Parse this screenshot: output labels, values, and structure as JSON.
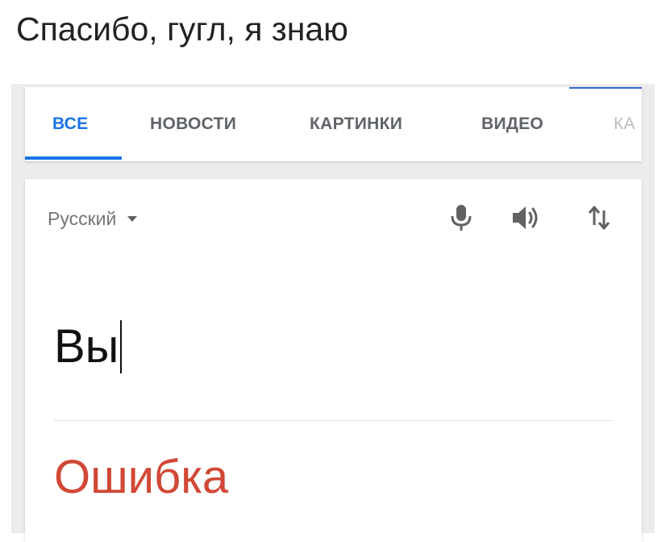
{
  "caption": "Спасибо, гугл, я знаю",
  "tabs": [
    {
      "label": "ВСЕ",
      "active": true
    },
    {
      "label": "НОВОСТИ",
      "active": false
    },
    {
      "label": "КАРТИНКИ",
      "active": false
    },
    {
      "label": "ВИДЕО",
      "active": false
    },
    {
      "label": "КА",
      "active": false
    }
  ],
  "translator": {
    "source_language": "Русский",
    "input_value": "Вы",
    "result_text": "Ошибка",
    "icons": [
      "microphone-icon",
      "speaker-icon",
      "swap-icon"
    ]
  },
  "colors": {
    "tab_active": "#1a73e8",
    "tab_inactive": "#5f6368",
    "error_text": "#d14836"
  }
}
